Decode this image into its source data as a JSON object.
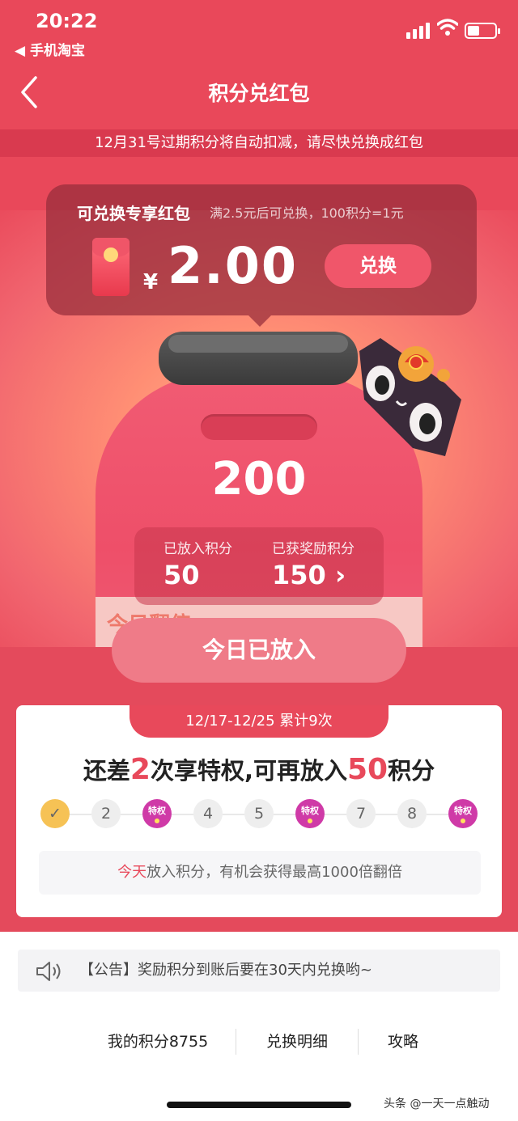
{
  "status_bar": {
    "time": "20:22",
    "back_app": "◀ 手机淘宝"
  },
  "nav": {
    "title": "积分兑红包"
  },
  "notice": "12月31号过期积分将自动扣减，请尽快兑换成红包",
  "redpacket": {
    "title": "可兑换专享红包",
    "subtitle": "满2.5元后可兑换，100积分=1元",
    "currency": "¥",
    "amount": "2.00",
    "exchange_button": "兑换"
  },
  "jar": {
    "total_points": "200",
    "label_text": "今日翻倍",
    "put_label": "已放入积分",
    "put_value": "50",
    "reward_label": "已获奖励积分",
    "reward_value": "150",
    "reward_arrow": "›"
  },
  "put_button": "今日已放入",
  "privilege": {
    "period": "12/17-12/25 累计9次",
    "heading_part1": "还差",
    "heading_num1": "2",
    "heading_part2": "次享特权,可再放入",
    "heading_num2": "50",
    "heading_part3": "积分",
    "steps": [
      {
        "label": "✓",
        "type": "done"
      },
      {
        "label": "2",
        "type": "normal"
      },
      {
        "label": "特权",
        "type": "priv"
      },
      {
        "label": "4",
        "type": "normal"
      },
      {
        "label": "5",
        "type": "normal"
      },
      {
        "label": "特权",
        "type": "priv"
      },
      {
        "label": "7",
        "type": "normal"
      },
      {
        "label": "8",
        "type": "normal"
      },
      {
        "label": "特权",
        "type": "priv"
      }
    ],
    "tip_accent": "今天",
    "tip_rest": "放入积分，有机会获得最高1000倍翻倍"
  },
  "announcement": "【公告】奖励积分到账后要在30天内兑换哟~",
  "footer": {
    "my_points": "我的积分8755",
    "exchange_detail": "兑换明细",
    "guide": "攻略"
  },
  "watermark": "头条 @一天一点触动",
  "colors": {
    "brand_red": "#e8495b",
    "done_yellow": "#f6c255",
    "privilege_purple": "#cf3aa7"
  }
}
